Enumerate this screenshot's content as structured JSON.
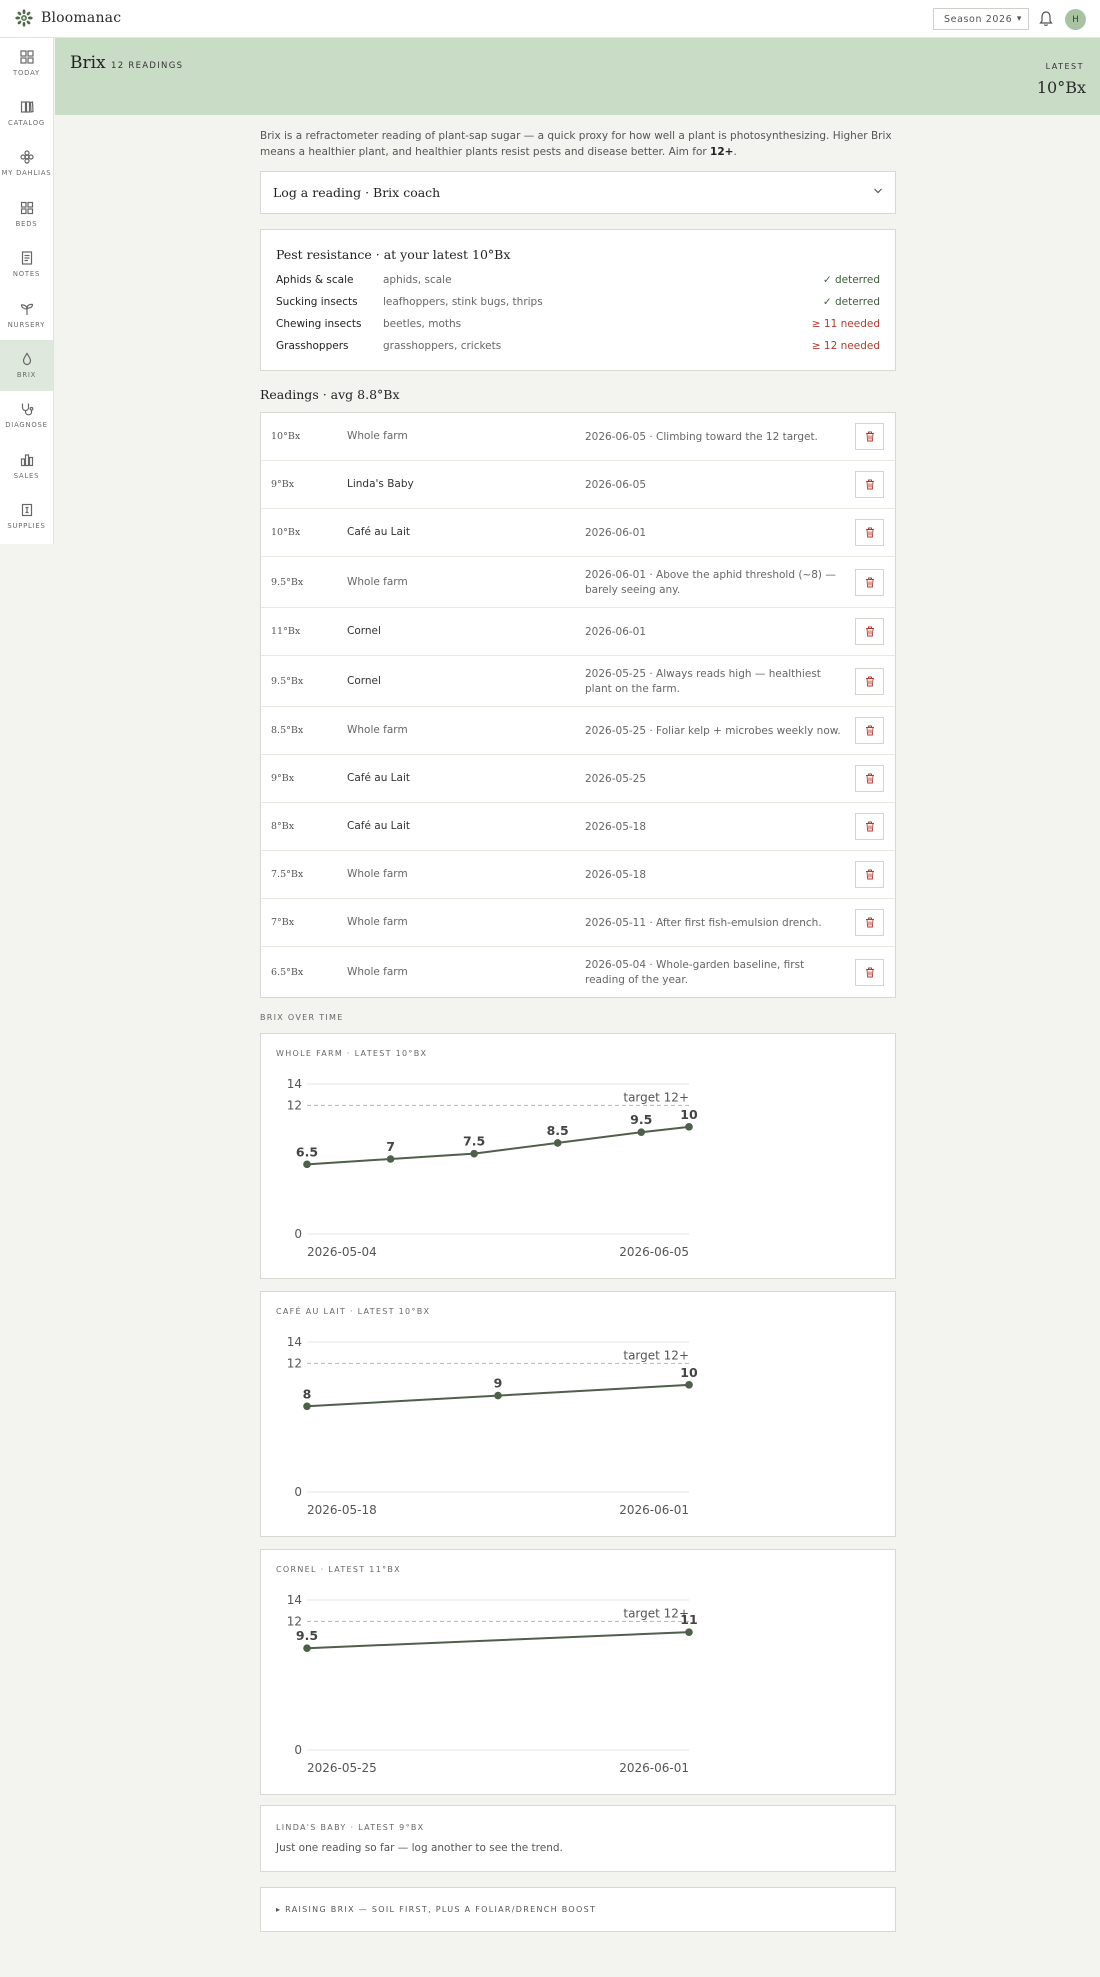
{
  "app": {
    "name": "Bloomanac"
  },
  "topbar": {
    "season_selected": "Season 2026",
    "avatar_initial": "H"
  },
  "sidebar": {
    "items": [
      {
        "label": "TODAY",
        "icon": "grid-icon"
      },
      {
        "label": "CATALOG",
        "icon": "book-icon"
      },
      {
        "label": "MY DAHLIAS",
        "icon": "flower-icon"
      },
      {
        "label": "BEDS",
        "icon": "beds-icon"
      },
      {
        "label": "NOTES",
        "icon": "notes-icon"
      },
      {
        "label": "NURSERY",
        "icon": "sprout-icon"
      },
      {
        "label": "BRIX",
        "icon": "drop-icon"
      },
      {
        "label": "DIAGNOSE",
        "icon": "stethoscope-icon"
      },
      {
        "label": "SALES",
        "icon": "bar-chart-icon"
      },
      {
        "label": "SUPPLIES",
        "icon": "supplies-icon"
      }
    ],
    "active": "BRIX"
  },
  "header": {
    "title": "Brix",
    "count": "12 READINGS",
    "latest_label": "LATEST",
    "latest_value": "10°Bx"
  },
  "intro": {
    "text": "Brix is a refractometer reading of plant-sap sugar — a quick proxy for how well a plant is photosynthesizing. Higher Brix means a healthier plant, and healthier plants resist pests and disease better. Aim for ",
    "target": "12+",
    "end": "."
  },
  "log": {
    "title": "Log a reading · Brix coach"
  },
  "pests": {
    "title": "Pest resistance · at your latest 10°Bx",
    "rows": [
      {
        "name": "Aphids & scale",
        "desc": "aphids, scale",
        "status": "✓ deterred",
        "ok": true
      },
      {
        "name": "Sucking insects",
        "desc": "leafhoppers, stink bugs, thrips",
        "status": "✓ deterred",
        "ok": true
      },
      {
        "name": "Chewing insects",
        "desc": "beetles, moths",
        "status": "≥ 11 needed",
        "ok": false
      },
      {
        "name": "Grasshoppers",
        "desc": "grasshoppers, crickets",
        "status": "≥ 12 needed",
        "ok": false
      }
    ]
  },
  "readings": {
    "title": "Readings · avg 8.8°Bx",
    "rows": [
      {
        "value": "10°Bx",
        "bed": "Whole farm",
        "note": "2026-06-05 · Climbing toward the 12 target."
      },
      {
        "value": "9°Bx",
        "bed": "Linda's Baby",
        "note": "2026-06-05"
      },
      {
        "value": "10°Bx",
        "bed": "Café au Lait",
        "note": "2026-06-01"
      },
      {
        "value": "9.5°Bx",
        "bed": "Whole farm",
        "note": "2026-06-01 · Above the aphid threshold (~8) — barely seeing any."
      },
      {
        "value": "11°Bx",
        "bed": "Cornel",
        "note": "2026-06-01"
      },
      {
        "value": "9.5°Bx",
        "bed": "Cornel",
        "note": "2026-05-25 · Always reads high — healthiest plant on the farm."
      },
      {
        "value": "8.5°Bx",
        "bed": "Whole farm",
        "note": "2026-05-25 · Foliar kelp + microbes weekly now."
      },
      {
        "value": "9°Bx",
        "bed": "Café au Lait",
        "note": "2026-05-25"
      },
      {
        "value": "8°Bx",
        "bed": "Café au Lait",
        "note": "2026-05-18"
      },
      {
        "value": "7.5°Bx",
        "bed": "Whole farm",
        "note": "2026-05-18"
      },
      {
        "value": "7°Bx",
        "bed": "Whole farm",
        "note": "2026-05-11 · After first fish-emulsion drench."
      },
      {
        "value": "6.5°Bx",
        "bed": "Whole farm",
        "note": "2026-05-04 · Whole-garden baseline, first reading of the year."
      }
    ]
  },
  "over_time_label": "BRIX OVER TIME",
  "chart_data": [
    {
      "type": "line",
      "title": "WHOLE FARM · LATEST 10°BX",
      "x": [
        "2026-05-04",
        "2026-05-11",
        "2026-05-18",
        "2026-05-25",
        "2026-06-01",
        "2026-06-05"
      ],
      "values": [
        6.5,
        7,
        7.5,
        8.5,
        9.5,
        10
      ],
      "data_labels": [
        "6.5",
        "7",
        "7.5",
        "8.5",
        "9.5",
        "10"
      ],
      "x_tick_labels": [
        "2026-05-04",
        "2026-06-05"
      ],
      "y_ticks": [
        "0",
        "12",
        "14"
      ],
      "ylim": [
        0,
        14
      ],
      "target": 12,
      "target_label": "target 12+"
    },
    {
      "type": "line",
      "title": "CAFÉ AU LAIT · LATEST 10°BX",
      "x": [
        "2026-05-18",
        "2026-05-25",
        "2026-06-01"
      ],
      "values": [
        8,
        9,
        10
      ],
      "data_labels": [
        "8",
        "9",
        "10"
      ],
      "x_tick_labels": [
        "2026-05-18",
        "2026-06-01"
      ],
      "y_ticks": [
        "0",
        "12",
        "14"
      ],
      "ylim": [
        0,
        14
      ],
      "target": 12,
      "target_label": "target 12+"
    },
    {
      "type": "line",
      "title": "CORNEL · LATEST 11°BX",
      "x": [
        "2026-05-25",
        "2026-06-01"
      ],
      "values": [
        9.5,
        11
      ],
      "data_labels": [
        "9.5",
        "11"
      ],
      "x_tick_labels": [
        "2026-05-25",
        "2026-06-01"
      ],
      "y_ticks": [
        "0",
        "12",
        "14"
      ],
      "ylim": [
        0,
        14
      ],
      "target": 12,
      "target_label": "target 12+"
    }
  ],
  "linda": {
    "title": "LINDA'S BABY · LATEST 9°BX",
    "text": "Just one reading so far — log another to see the trend."
  },
  "raising": {
    "label": "▸ RAISING BRIX — SOIL FIRST, PLUS A FOLIAR/DRENCH BOOST"
  },
  "colors": {
    "accent": "#4e5f4a",
    "header_band": "#c9dcc5",
    "danger": "#b3392b",
    "ok": "#3d5c3a"
  }
}
